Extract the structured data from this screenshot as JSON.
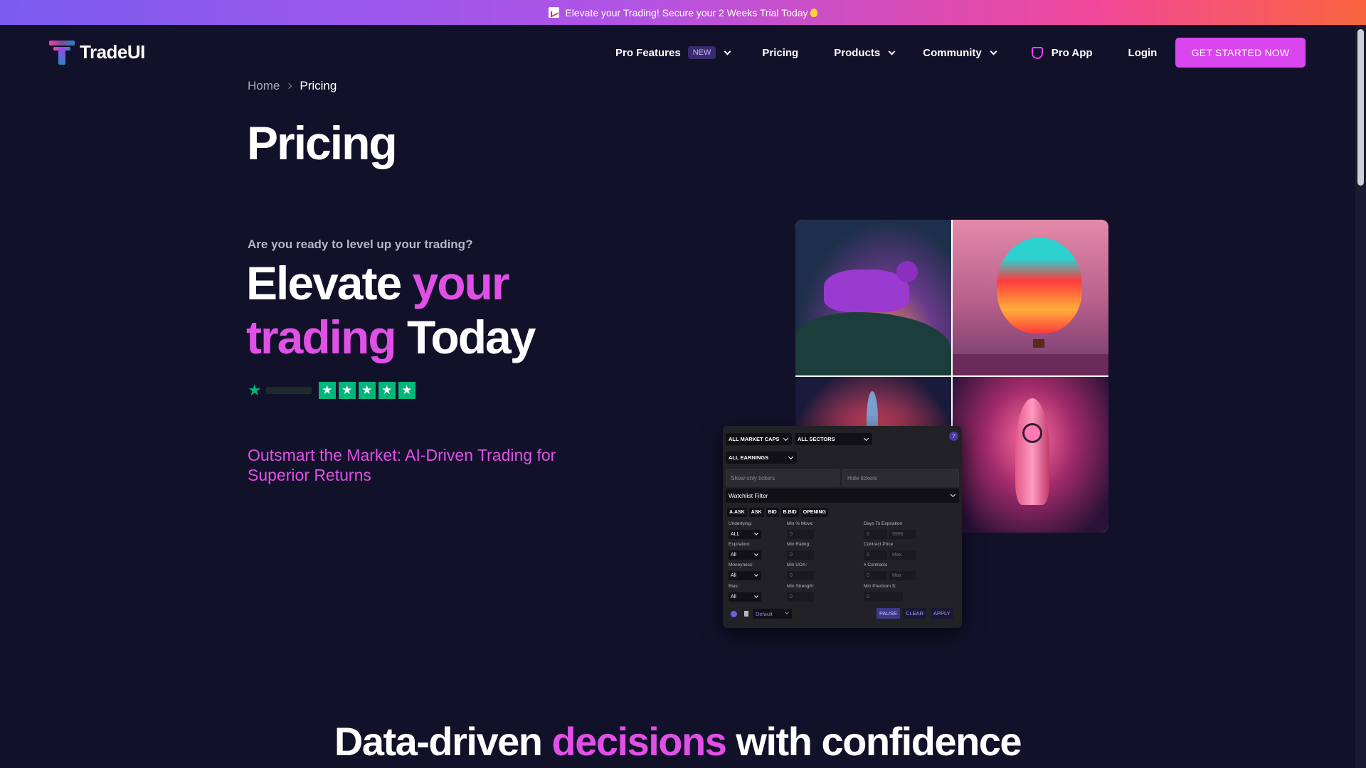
{
  "promo": {
    "text": "Elevate your Trading! Secure your 2 Weeks Trial Today"
  },
  "brand": {
    "name": "TradeUI"
  },
  "nav": {
    "pro_features": "Pro Features",
    "new_badge": "NEW",
    "pricing": "Pricing",
    "products": "Products",
    "community": "Community",
    "pro_app": "Pro App",
    "login": "Login",
    "cta": "GET STARTED NOW"
  },
  "breadcrumb": {
    "home": "Home",
    "current": "Pricing"
  },
  "page_title": "Pricing",
  "hero": {
    "eyebrow": "Are you ready to level up your trading?",
    "line1_plain": "Elevate ",
    "line1_accent": "your",
    "line2_accent": "trading",
    "line2_plain": " Today",
    "stars": 5,
    "tagline": "Outsmart the Market: AI-Driven Trading for Superior Returns"
  },
  "panel": {
    "market_caps": "ALL MARKET CAPS",
    "sectors": "ALL SECTORS",
    "earnings": "ALL EARNINGS",
    "show_tickers_placeholder": "Show only tickers",
    "hide_tickers_placeholder": "Hide tickers",
    "watchlist": "Watchlist Filter",
    "chips": [
      "A.ASK",
      "ASK",
      "BID",
      "B.BID",
      "OPENING"
    ],
    "underlying_label": "Underlying:",
    "underlying_value": "ALL",
    "expiration_label": "Expiration:",
    "expiration_value": "All",
    "moneyness_label": "Moneyness:",
    "moneyness_value": "All",
    "bias_label": "Bias:",
    "bias_value": "All",
    "min_move_label": "Min % Move:",
    "min_move_value": "0",
    "min_rating_label": "Min Rating:",
    "min_rating_value": "0",
    "min_uoa_label": "Min UOA:",
    "min_uoa_value": "0",
    "min_strength_label": "Min Strength:",
    "min_strength_value": "0",
    "days_label": "Days To Expiration",
    "days_min": "0",
    "days_max": "9999",
    "contract_price_label": "Contract Price",
    "contract_min": "0",
    "contract_max": "Max",
    "contracts_label": "# Contracts",
    "contracts_min": "0",
    "contracts_max": "Max",
    "min_premium_label": "Min Premium $:",
    "min_premium_value": "0",
    "preset": "Default",
    "pause": "PAUSE",
    "clear": "CLEAR",
    "apply": "APPLY"
  },
  "section": {
    "heading_plain1": "Data-driven ",
    "heading_accent": "decisions",
    "heading_plain2": " with confidence"
  },
  "colors": {
    "accent": "#e150e6",
    "background": "#12112a",
    "trustpilot": "#00b67a"
  }
}
